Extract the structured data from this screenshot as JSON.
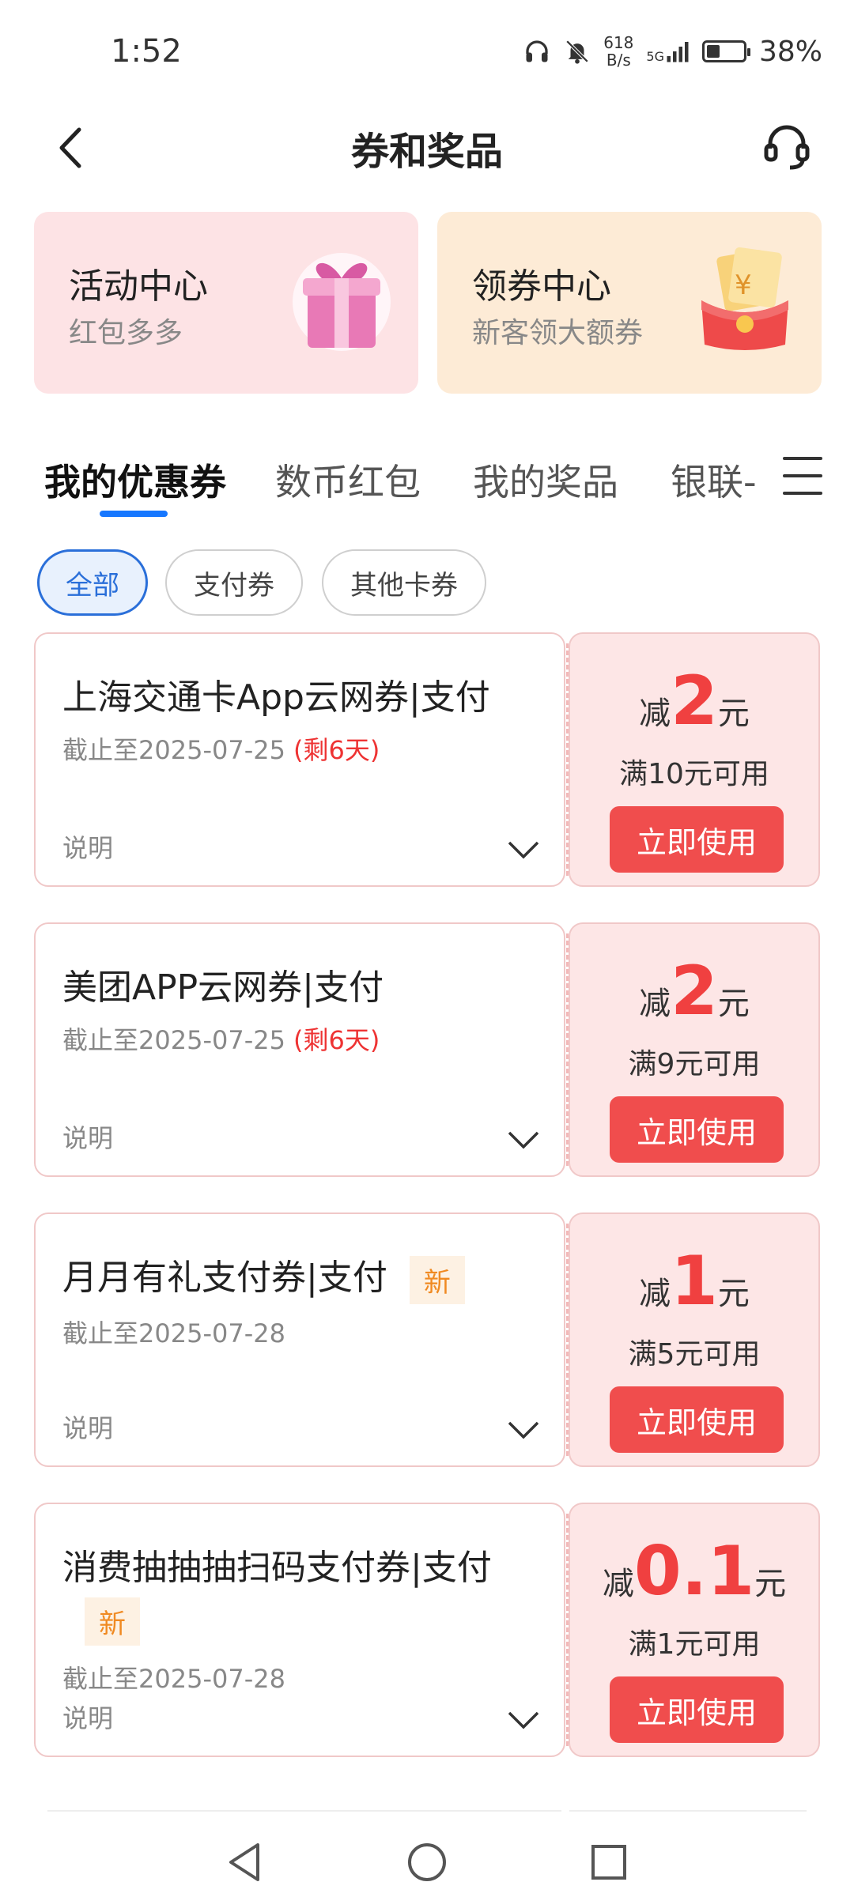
{
  "status_bar": {
    "time": "1:52",
    "net_speed_value": "618",
    "net_speed_unit": "B/s",
    "signal_label": "5G",
    "battery": "38%"
  },
  "header": {
    "title": "券和奖品"
  },
  "promos": [
    {
      "title": "活动中心",
      "subtitle": "红包多多",
      "icon": "gift-box-icon"
    },
    {
      "title": "领券中心",
      "subtitle": "新客领大额券",
      "icon": "red-envelope-coupon-icon"
    }
  ],
  "tabs": [
    {
      "label": "我的优惠券",
      "active": true
    },
    {
      "label": "数币红包",
      "active": false
    },
    {
      "label": "我的奖品",
      "active": false
    },
    {
      "label": "银联-",
      "active": false
    }
  ],
  "filters": [
    {
      "label": "全部",
      "active": true
    },
    {
      "label": "支付券",
      "active": false
    },
    {
      "label": "其他卡券",
      "active": false
    }
  ],
  "coupons": [
    {
      "name": "上海交通卡App云网券|支付",
      "new_badge": "",
      "date": "截止至2025-07-25",
      "remaining": "(剩6天)",
      "info": "说明",
      "minus": "减",
      "amount": "2",
      "yuan": "元",
      "condition": "满10元可用",
      "button": "立即使用"
    },
    {
      "name": "美团APP云网券|支付",
      "new_badge": "",
      "date": "截止至2025-07-25",
      "remaining": "(剩6天)",
      "info": "说明",
      "minus": "减",
      "amount": "2",
      "yuan": "元",
      "condition": "满9元可用",
      "button": "立即使用"
    },
    {
      "name": "月月有礼支付券|支付",
      "new_badge": "新",
      "date": "截止至2025-07-28",
      "remaining": "",
      "info": "说明",
      "minus": "减",
      "amount": "1",
      "yuan": "元",
      "condition": "满5元可用",
      "button": "立即使用"
    },
    {
      "name": "消费抽抽抽扫码支付券|支付",
      "new_badge": "新",
      "date": "截止至2025-07-28",
      "remaining": "",
      "info": "说明",
      "minus": "减",
      "amount": "0.1",
      "yuan": "元",
      "condition": "满1元可用",
      "button": "立即使用"
    }
  ],
  "colors": {
    "accent_blue": "#1677ff",
    "coupon_red": "#f04d4d",
    "badge_orange": "#f08a22"
  }
}
